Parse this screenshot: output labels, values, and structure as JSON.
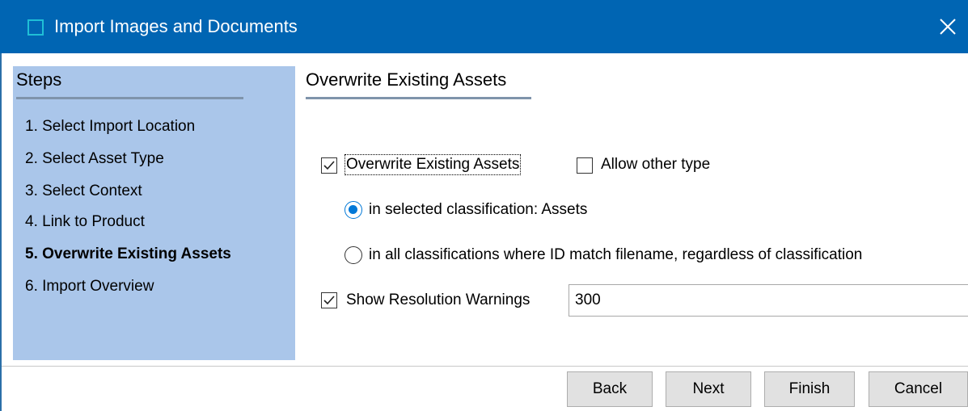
{
  "window": {
    "title": "Import Images and Documents",
    "app_icon": "square-outline-icon",
    "close_icon": "close-icon"
  },
  "steps": {
    "heading": "Steps",
    "items": [
      {
        "label": "1. Select Import Location",
        "active": false
      },
      {
        "label": "2. Select Asset Type",
        "active": false
      },
      {
        "label": "3. Select Context",
        "active": false
      },
      {
        "label": "4. Link to Product",
        "active": false
      },
      {
        "label": "5. Overwrite Existing Assets",
        "active": true
      },
      {
        "label": "6. Import Overview",
        "active": false
      }
    ]
  },
  "content": {
    "heading": "Overwrite Existing Assets",
    "overwrite_checkbox": {
      "label": "Overwrite Existing Assets",
      "checked": true
    },
    "allow_other_type_checkbox": {
      "label": "Allow other type",
      "checked": false
    },
    "radio_selected_classification": {
      "label": "in selected classification: Assets",
      "checked": true
    },
    "radio_all_classifications": {
      "label": "in all classifications where ID match filename, regardless of classification",
      "checked": false
    },
    "resolution_warnings_checkbox": {
      "label": "Show Resolution Warnings",
      "checked": true
    },
    "resolution_value": "300"
  },
  "buttons": {
    "back": "Back",
    "next": "Next",
    "finish": "Finish",
    "cancel": "Cancel"
  },
  "colors": {
    "titlebar": "#0065b3",
    "steps_panel": "#aac6ea",
    "accent": "#0078d7"
  }
}
